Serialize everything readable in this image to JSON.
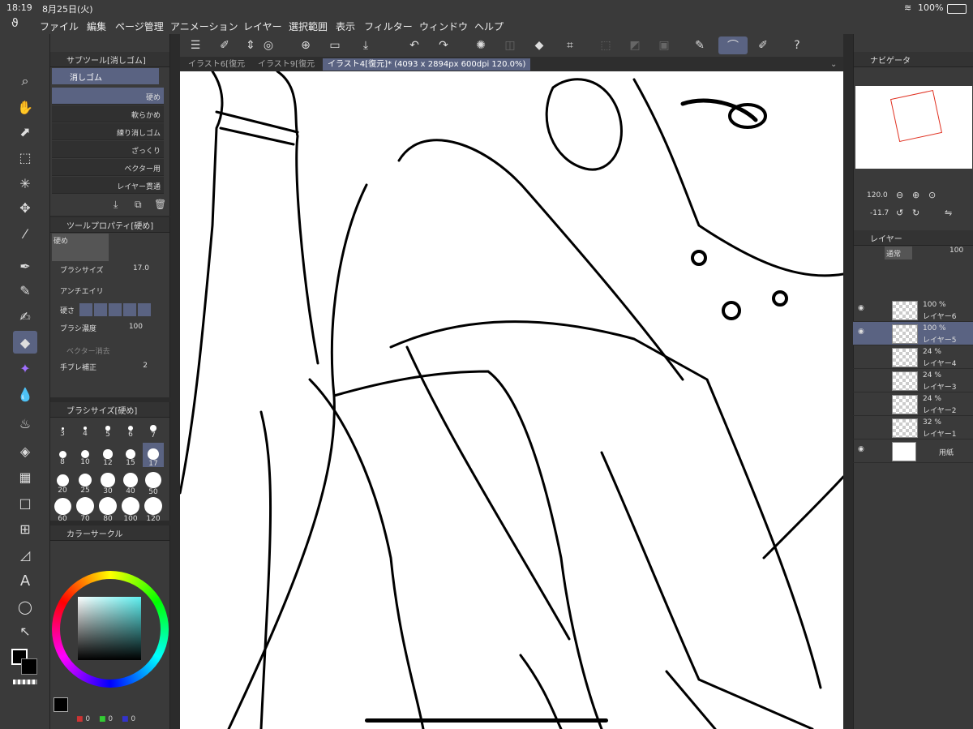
{
  "status": {
    "time": "18:19",
    "date": "8月25日(火)",
    "battery": "100%"
  },
  "menu": [
    "ファイル",
    "編集",
    "ページ管理",
    "アニメーション",
    "レイヤー",
    "選択範囲",
    "表示",
    "フィルター",
    "ウィンドウ",
    "ヘルプ"
  ],
  "subtool": {
    "title": "サブツール[消しゴム]",
    "group": "消しゴム",
    "brushes": [
      "硬め",
      "軟らかめ",
      "練り消しゴム",
      "ざっくり",
      "ベクター用",
      "レイヤー貫通"
    ]
  },
  "toolprop": {
    "title": "ツールプロパティ[硬め]",
    "preset": "硬め",
    "brush_size_label": "ブラシサイズ",
    "brush_size_value": "17.0",
    "antialias_label": "アンチエイリ",
    "hardness_label": "硬さ",
    "density_label": "ブラシ濃度",
    "density_value": "100",
    "vector_label": "ベクター消去",
    "stabilizer_label": "手ブレ補正",
    "stabilizer_value": "2"
  },
  "brushsize": {
    "title": "ブラシサイズ[硬め]",
    "sizes": [
      "3",
      "4",
      "5",
      "6",
      "7",
      "8",
      "10",
      "12",
      "15",
      "17",
      "20",
      "25",
      "30",
      "40",
      "50",
      "60",
      "70",
      "80",
      "100",
      "120"
    ]
  },
  "colorcircle": {
    "title": "カラーサークル",
    "r": "0",
    "g": "0",
    "b": "0"
  },
  "tabs": [
    "イラスト6[復元",
    "イラスト9[復元",
    "イラスト4[復元]* (4093 x 2894px 600dpi 120.0%)"
  ],
  "navigator": {
    "title": "ナビゲータ",
    "zoom": "120.0",
    "rotation": "-11.7"
  },
  "layers": {
    "title": "レイヤー",
    "blend": "通常",
    "opacity": "100",
    "items": [
      {
        "pct": "100 %",
        "mode": "通",
        "name": "レイヤー6",
        "visible": true
      },
      {
        "pct": "100 %",
        "mode": "通",
        "name": "レイヤー5",
        "visible": true
      },
      {
        "pct": "24 %",
        "mode": "通",
        "name": "レイヤー4",
        "visible": false
      },
      {
        "pct": "24 %",
        "mode": "通",
        "name": "レイヤー3",
        "visible": false
      },
      {
        "pct": "24 %",
        "mode": "通",
        "name": "レイヤー2",
        "visible": false
      },
      {
        "pct": "32 %",
        "mode": "通",
        "name": "レイヤー1",
        "visible": false
      },
      {
        "pct": "",
        "mode": "",
        "name": "用紙",
        "visible": true
      }
    ]
  },
  "colors": {
    "accent": "#5a6382",
    "panel": "#3a3a3a",
    "canvas": "#ffffff"
  }
}
